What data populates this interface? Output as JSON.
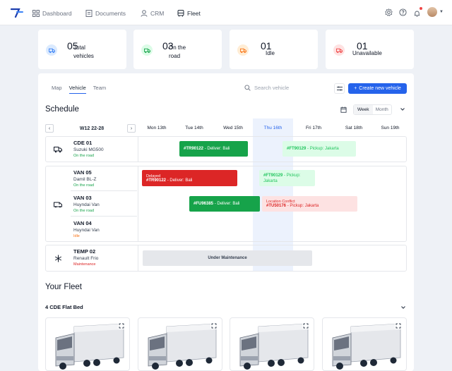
{
  "nav": {
    "items": [
      {
        "label": "Dashboard",
        "icon": "grid-icon"
      },
      {
        "label": "Documents",
        "icon": "document-icon"
      },
      {
        "label": "CRM",
        "icon": "user-icon"
      },
      {
        "label": "Fleet",
        "icon": "bus-icon",
        "active": true
      }
    ],
    "right_icons": [
      "settings-icon",
      "help-icon",
      "bell-icon"
    ]
  },
  "stats": [
    {
      "value": "05",
      "label": "Total vehicles",
      "color": "#3b82f6",
      "bg": "#dbeafe"
    },
    {
      "value": "03",
      "label": "On the road",
      "color": "#16a34a",
      "bg": "#dcfce7"
    },
    {
      "value": "01",
      "label": "Idle",
      "color": "#f97316",
      "bg": "#ffedd5"
    },
    {
      "value": "01",
      "label": "Unavailable",
      "color": "#ef4444",
      "bg": "#fee2e2"
    }
  ],
  "tabs": [
    "Map",
    "Vehicle",
    "Team"
  ],
  "active_tab": "Vehicle",
  "search": {
    "placeholder": "Search vehicle"
  },
  "create_button": "Create new vehicle",
  "schedule": {
    "title": "Schedule",
    "view_options": [
      "Week",
      "Month"
    ],
    "selected_view": "Week",
    "week_label": "W12  22-28",
    "days": [
      "Mon 13th",
      "Tue 14th",
      "Wed 15th",
      "Thu 16th",
      "Fri 17th",
      "Sat 18th",
      "Sun 19th"
    ],
    "today": "Thu 16th"
  },
  "vehicles": [
    {
      "name": "CDE 01",
      "model": "Suzuki MG500",
      "status": "On the road",
      "status_color": "#16a34a"
    },
    {
      "name": "VAN 05",
      "model": "Damil BL-Z",
      "status": "On the road",
      "status_color": "#16a34a"
    },
    {
      "name": "VAN 03",
      "model": "Huyndai Van",
      "status": "On the road",
      "status_color": "#16a34a"
    },
    {
      "name": "VAN 04",
      "model": "Huyndai Van",
      "status": "Idle",
      "status_color": "#f97316"
    },
    {
      "name": "TEMP 02",
      "model": "Renault Frio",
      "status": "Maintenance",
      "status_color": "#dc2626"
    }
  ],
  "events": [
    {
      "code": "#TR90122",
      "text": " - Deliver: Bali"
    },
    {
      "code": "#FT90129",
      "text": " - Pickup: Jakarta"
    },
    {
      "label": "Delayed",
      "code": "#TR90122",
      "text": " - Deliver: Bali"
    },
    {
      "code": "#FT90129",
      "text": " - Pickup: Jakarta"
    },
    {
      "code": "#FU96385",
      "text": " - Deliver: Bali"
    },
    {
      "label": "Location Conflict",
      "code": "#TU50176",
      "text": " - Pickup: Jakarta"
    },
    {
      "text": "Under Maintenance"
    }
  ],
  "fleet": {
    "title": "Your Fleet",
    "group_label": "4 CDE Flat Bed",
    "cards": [
      "truck-image",
      "truck-image",
      "truck-image",
      "truck-image"
    ]
  }
}
